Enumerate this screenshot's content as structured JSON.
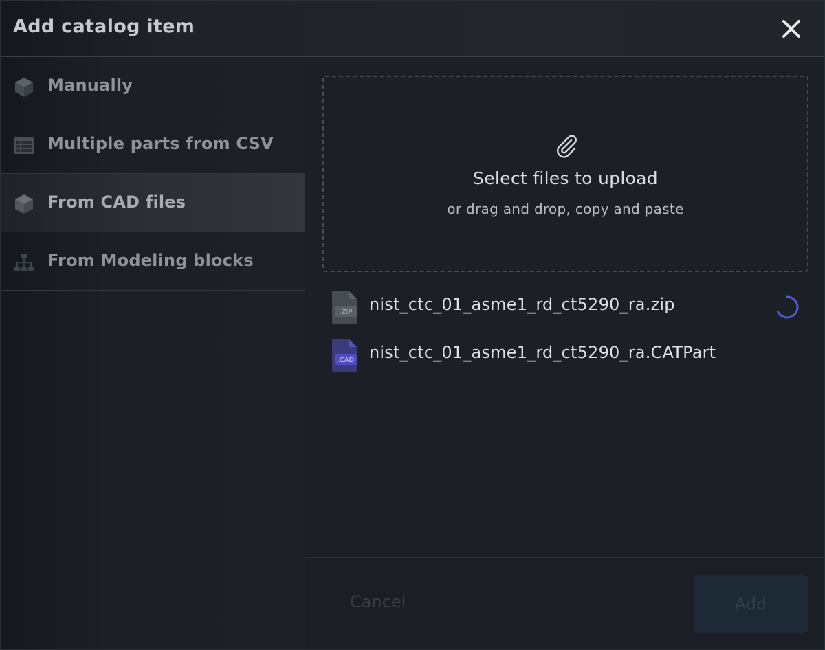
{
  "dialog": {
    "title": "Add catalog item",
    "close_icon": "close-icon"
  },
  "sidebar": {
    "items": [
      {
        "label": "Manually",
        "icon": "cube-icon",
        "active": false
      },
      {
        "label": "Multiple parts from CSV",
        "icon": "table-icon",
        "active": false
      },
      {
        "label": "From CAD files",
        "icon": "cube-icon",
        "active": true
      },
      {
        "label": "From Modeling blocks",
        "icon": "hierarchy-icon",
        "active": false
      }
    ]
  },
  "upload": {
    "icon": "paperclip-icon",
    "title": "Select files to upload",
    "subtitle": "or drag and drop, copy and paste"
  },
  "files": [
    {
      "name": "nist_ctc_01_asme1_rd_ct5290_ra.zip",
      "badge": ".ZIP",
      "icon": "zip-file-icon",
      "loading": true
    },
    {
      "name": "nist_ctc_01_asme1_rd_ct5290_ra.CATPart",
      "badge": ".CAD",
      "icon": "cad-file-icon",
      "loading": false
    }
  ],
  "footer": {
    "cancel_label": "Cancel",
    "add_label": "Add"
  },
  "colors": {
    "background": "#1b1e24",
    "accent": "#4b5bd6",
    "cad_badge": "#3b3a7a"
  }
}
